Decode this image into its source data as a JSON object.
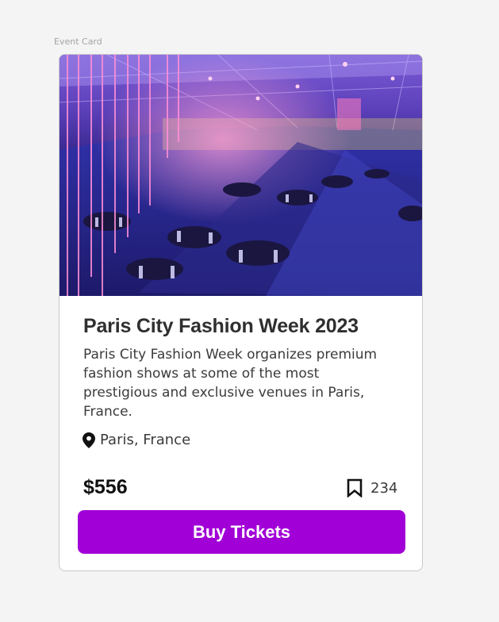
{
  "frame": {
    "label": "Event Card"
  },
  "event": {
    "title": "Paris City Fashion Week 2023",
    "description": "Paris City Fashion Week organizes premium fashion shows at some of the most prestigious and exclusive venues in Paris, France.",
    "location": "Paris, France",
    "price": "$556",
    "bookmark_count": "234",
    "cta_label": "Buy Tickets",
    "location_icon": "map-pin-icon",
    "bookmark_icon": "bookmark-icon"
  },
  "colors": {
    "cta_background": "#a100d6",
    "cta_text": "#ffffff",
    "title": "#2f2f2f",
    "price": "#111111"
  }
}
